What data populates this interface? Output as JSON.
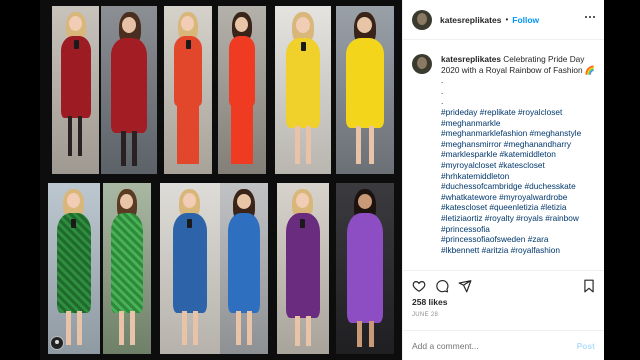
{
  "header": {
    "username": "katesreplikates",
    "separator": "•",
    "follow_label": "Follow",
    "more_icon": "more-horizontal-icon"
  },
  "caption": {
    "username": "katesreplikates",
    "text": "Celebrating Pride Day 2020 with a Royal Rainbow of Fashion",
    "emoji": "🌈",
    "dots": [
      ".",
      ".",
      "."
    ],
    "hashtags": [
      "#prideday #replikate #royalcloset",
      "#meghanmarkle",
      "#meghanmarklefashion #meghanstyle",
      "#meghansmirror #meghanandharry",
      "#marklesparkle #katemiddleton",
      "#myroyalcloset #katescloset",
      "#hrhkatemiddleton",
      "#duchessofcambridge #duchesskate",
      "#whatkatewore #myroyalwardrobe",
      "#katescloset #queenletizia #letizia",
      "#letiziaortiz #royalty #royals #rainbow",
      "#princessofia",
      "#princessofiaofsweden #zara",
      "#lkbennett #aritzia #royalfashion"
    ]
  },
  "actions": {
    "like_icon": "heart-icon",
    "comment_icon": "comment-icon",
    "share_icon": "share-icon",
    "save_icon": "bookmark-icon"
  },
  "likes": "258 likes",
  "date": "JUNE 28",
  "comment": {
    "placeholder": "Add a comment...",
    "post_label": "Post"
  },
  "colors": {
    "follow": "#0095f6",
    "hashtag": "#00376b",
    "post_disabled": "#b2dffc"
  }
}
